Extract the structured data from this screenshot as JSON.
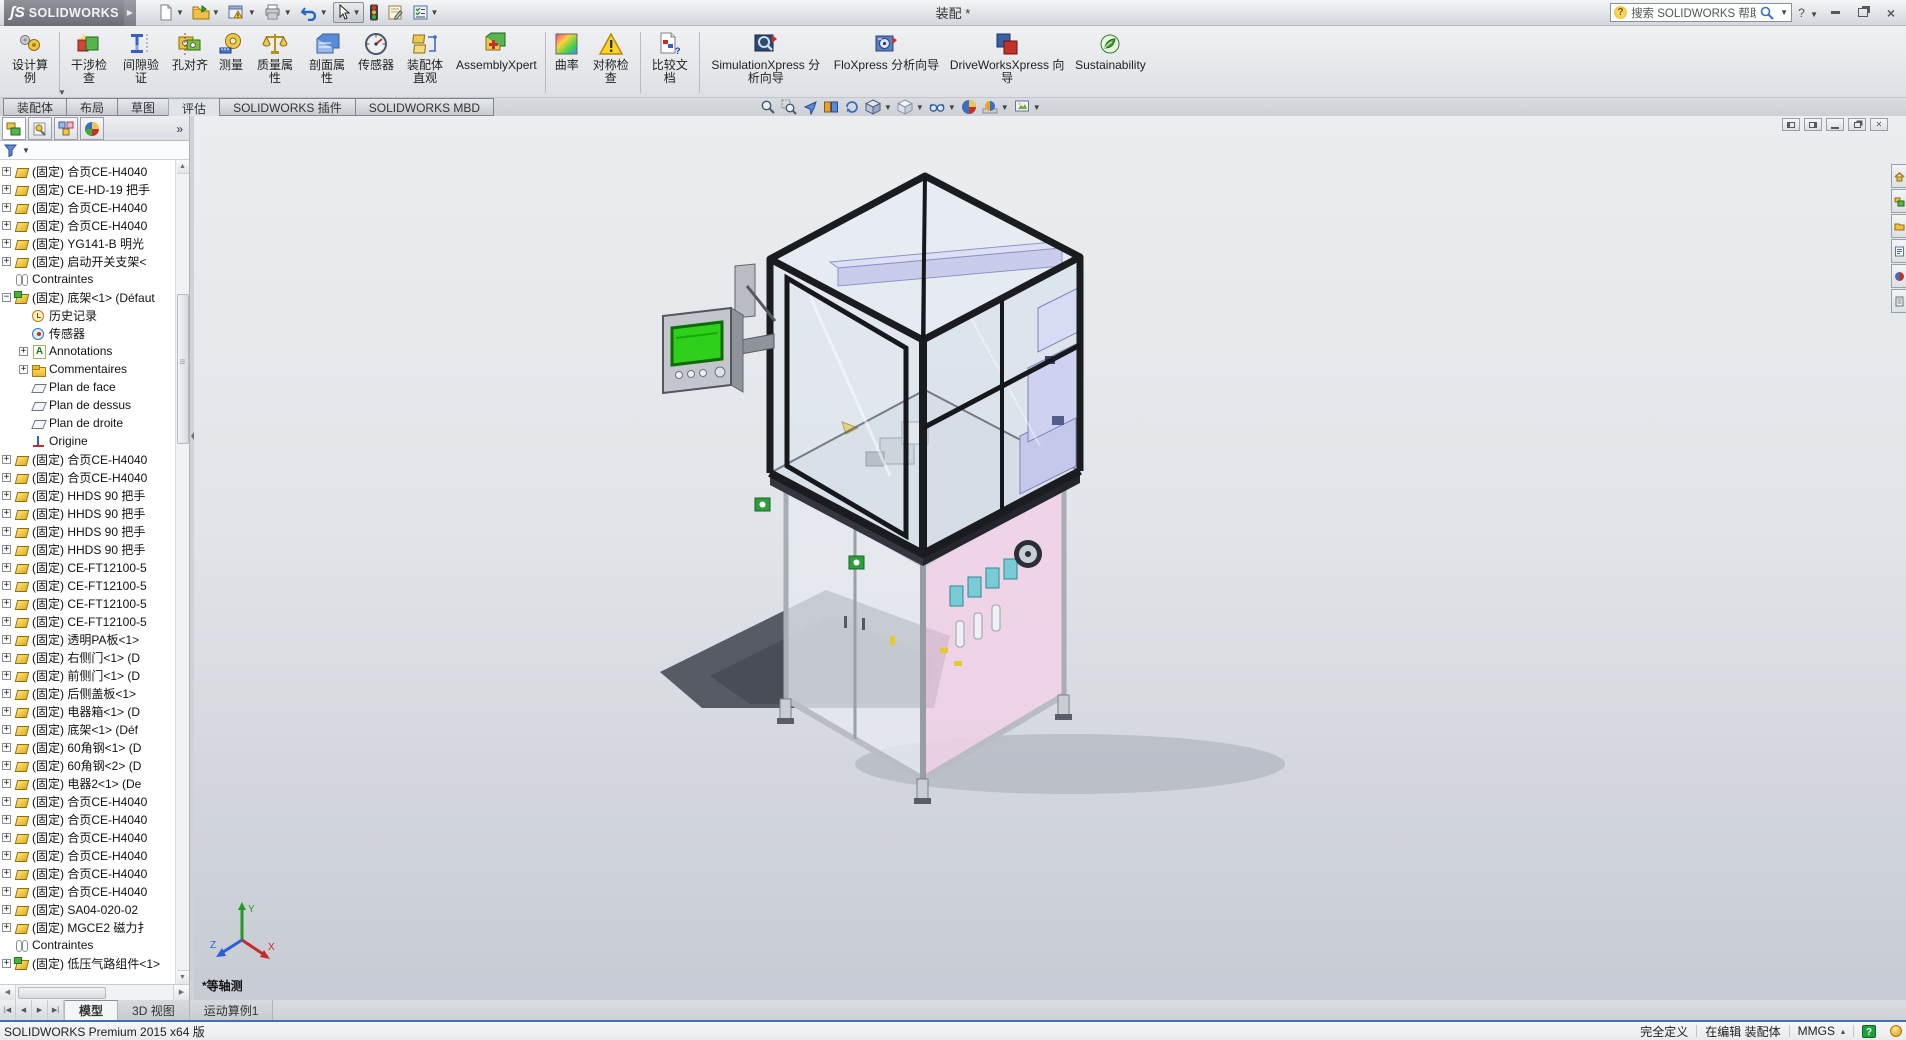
{
  "titlebar": {
    "logo_text": "SOLIDWORKS",
    "title": "装配 *",
    "search_text": "搜索 SOLIDWORKS 帮助",
    "qat_icons": [
      "new-document",
      "open",
      "publish-edrawings",
      "print",
      "undo",
      "select-cursor",
      "rebuild-traffic-light",
      "options-note",
      "task-checklist"
    ]
  },
  "ribbon": {
    "buttons": [
      {
        "label": "设计算例"
      },
      {
        "label": "干涉检查"
      },
      {
        "label": "间隙验证"
      },
      {
        "label": "孔对齐"
      },
      {
        "label": "测量"
      },
      {
        "label": "质量属性"
      },
      {
        "label": "剖面属性"
      },
      {
        "label": "传感器"
      },
      {
        "label": "装配体直观"
      },
      {
        "label": "AssemblyXpert"
      },
      {
        "label": "曲率"
      },
      {
        "label": "对称检查"
      },
      {
        "label": "比较文档"
      },
      {
        "label": "SimulationXpress 分析向导"
      },
      {
        "label": "FloXpress 分析向导"
      },
      {
        "label": "DriveWorksXpress 向导"
      },
      {
        "label": "Sustainability"
      }
    ]
  },
  "command_tabs": {
    "items": [
      {
        "label": "装配体"
      },
      {
        "label": "布局"
      },
      {
        "label": "草图"
      },
      {
        "label": "评估",
        "active": true
      },
      {
        "label": "SOLIDWORKS 插件"
      },
      {
        "label": "SOLIDWORKS MBD"
      }
    ]
  },
  "hud_icons": [
    "zoom-fit",
    "zoom-area",
    "view-previous",
    "section-view",
    "rotate-view",
    "view-orientation",
    "display-style",
    "hide-show-items",
    "edit-appearance",
    "apply-scene",
    "view-settings"
  ],
  "feature_tree": {
    "panel_tabs": [
      "featuremanager",
      "propertymanager",
      "configurationmanager",
      "displaymanager"
    ],
    "overflow_chevron": "»",
    "items": [
      {
        "exp": "+",
        "type": "part",
        "label": "(固定) 合页CE-H4040"
      },
      {
        "exp": "+",
        "type": "part",
        "label": "(固定) CE-HD-19 把手"
      },
      {
        "exp": "+",
        "type": "part",
        "label": "(固定) 合页CE-H4040"
      },
      {
        "exp": "+",
        "type": "part",
        "label": "(固定) 合页CE-H4040"
      },
      {
        "exp": "+",
        "type": "part",
        "label": "(固定) YG141-B 明光"
      },
      {
        "exp": "+",
        "type": "part",
        "label": "(固定) 启动开关支架<"
      },
      {
        "type": "mates",
        "label": "Contraintes"
      },
      {
        "exp": "−",
        "type": "asm",
        "label": "(固定) 底架<1> (Défaut"
      },
      {
        "type": "history",
        "label": "历史记录",
        "indent": 1
      },
      {
        "type": "sensors",
        "label": "传感器",
        "indent": 1
      },
      {
        "exp": "+",
        "type": "annotations",
        "label": "Annotations",
        "indent": 1
      },
      {
        "exp": "+",
        "type": "comments",
        "label": "Commentaires",
        "indent": 1
      },
      {
        "type": "plane",
        "label": "Plan de face",
        "indent": 1
      },
      {
        "type": "plane",
        "label": "Plan de dessus",
        "indent": 1
      },
      {
        "type": "plane",
        "label": "Plan de droite",
        "indent": 1
      },
      {
        "type": "origin",
        "label": "Origine",
        "indent": 1
      },
      {
        "exp": "+",
        "type": "part",
        "label": "(固定) 合页CE-H4040"
      },
      {
        "exp": "+",
        "type": "part",
        "label": "(固定) 合页CE-H4040"
      },
      {
        "exp": "+",
        "type": "part",
        "label": "(固定) HHDS 90 把手"
      },
      {
        "exp": "+",
        "type": "part",
        "label": "(固定) HHDS 90 把手"
      },
      {
        "exp": "+",
        "type": "part",
        "label": "(固定) HHDS 90 把手"
      },
      {
        "exp": "+",
        "type": "part",
        "label": "(固定) HHDS 90 把手"
      },
      {
        "exp": "+",
        "type": "part",
        "label": "(固定) CE-FT12100-5"
      },
      {
        "exp": "+",
        "type": "part",
        "label": "(固定) CE-FT12100-5"
      },
      {
        "exp": "+",
        "type": "part",
        "label": "(固定) CE-FT12100-5"
      },
      {
        "exp": "+",
        "type": "part",
        "label": "(固定) CE-FT12100-5"
      },
      {
        "exp": "+",
        "type": "part",
        "label": "(固定) 透明PA板<1>"
      },
      {
        "exp": "+",
        "type": "part",
        "label": "(固定) 右侧门<1> (D"
      },
      {
        "exp": "+",
        "type": "part",
        "label": "(固定) 前侧门<1> (D"
      },
      {
        "exp": "+",
        "type": "part",
        "label": "(固定) 后侧盖板<1>"
      },
      {
        "exp": "+",
        "type": "part",
        "label": "(固定) 电器箱<1> (D"
      },
      {
        "exp": "+",
        "type": "part",
        "label": "(固定) 底架<1> (Déf"
      },
      {
        "exp": "+",
        "type": "part",
        "label": "(固定) 60角钢<1> (D"
      },
      {
        "exp": "+",
        "type": "part",
        "label": "(固定) 60角钢<2> (D"
      },
      {
        "exp": "+",
        "type": "part",
        "label": "(固定) 电器2<1> (De"
      },
      {
        "exp": "+",
        "type": "part",
        "label": "(固定) 合页CE-H4040"
      },
      {
        "exp": "+",
        "type": "part",
        "label": "(固定) 合页CE-H4040"
      },
      {
        "exp": "+",
        "type": "part",
        "label": "(固定) 合页CE-H4040"
      },
      {
        "exp": "+",
        "type": "part",
        "label": "(固定) 合页CE-H4040"
      },
      {
        "exp": "+",
        "type": "part",
        "label": "(固定) 合页CE-H4040"
      },
      {
        "exp": "+",
        "type": "part",
        "label": "(固定) 合页CE-H4040"
      },
      {
        "exp": "+",
        "type": "part",
        "label": "(固定) SA04-020-02"
      },
      {
        "exp": "+",
        "type": "part",
        "label": "(固定) MGCE2 磁力扌"
      },
      {
        "type": "mates",
        "label": "Contraintes"
      },
      {
        "exp": "+",
        "type": "asm",
        "label": "(固定) 低压气路组件<1>"
      }
    ]
  },
  "viewport": {
    "view_label": "*等轴测",
    "triad": {
      "x": "X",
      "y": "Y",
      "z": "Z"
    },
    "screen_green": "#2fd01c"
  },
  "taskpane_icons": [
    "home",
    "design-library",
    "file-explorer",
    "view-palette",
    "appearances-scenes",
    "custom-properties"
  ],
  "bottom_tabs": {
    "nav": [
      "|◀",
      "◀",
      "▶",
      "▶|"
    ],
    "items": [
      {
        "label": "模型",
        "active": true
      },
      {
        "label": "3D 视图"
      },
      {
        "label": "运动算例1"
      }
    ]
  },
  "statusbar": {
    "app": "SOLIDWORKS Premium 2015 x64 版",
    "define_state": "完全定义",
    "edit_state": "在编辑 装配体",
    "units": "MMGS",
    "units_arrow": "▴",
    "help": "?"
  },
  "colors": {
    "accent_blue": "#3f6fb5",
    "part_yellow": "#e8c53a",
    "screen_green": "#2fd01c"
  }
}
